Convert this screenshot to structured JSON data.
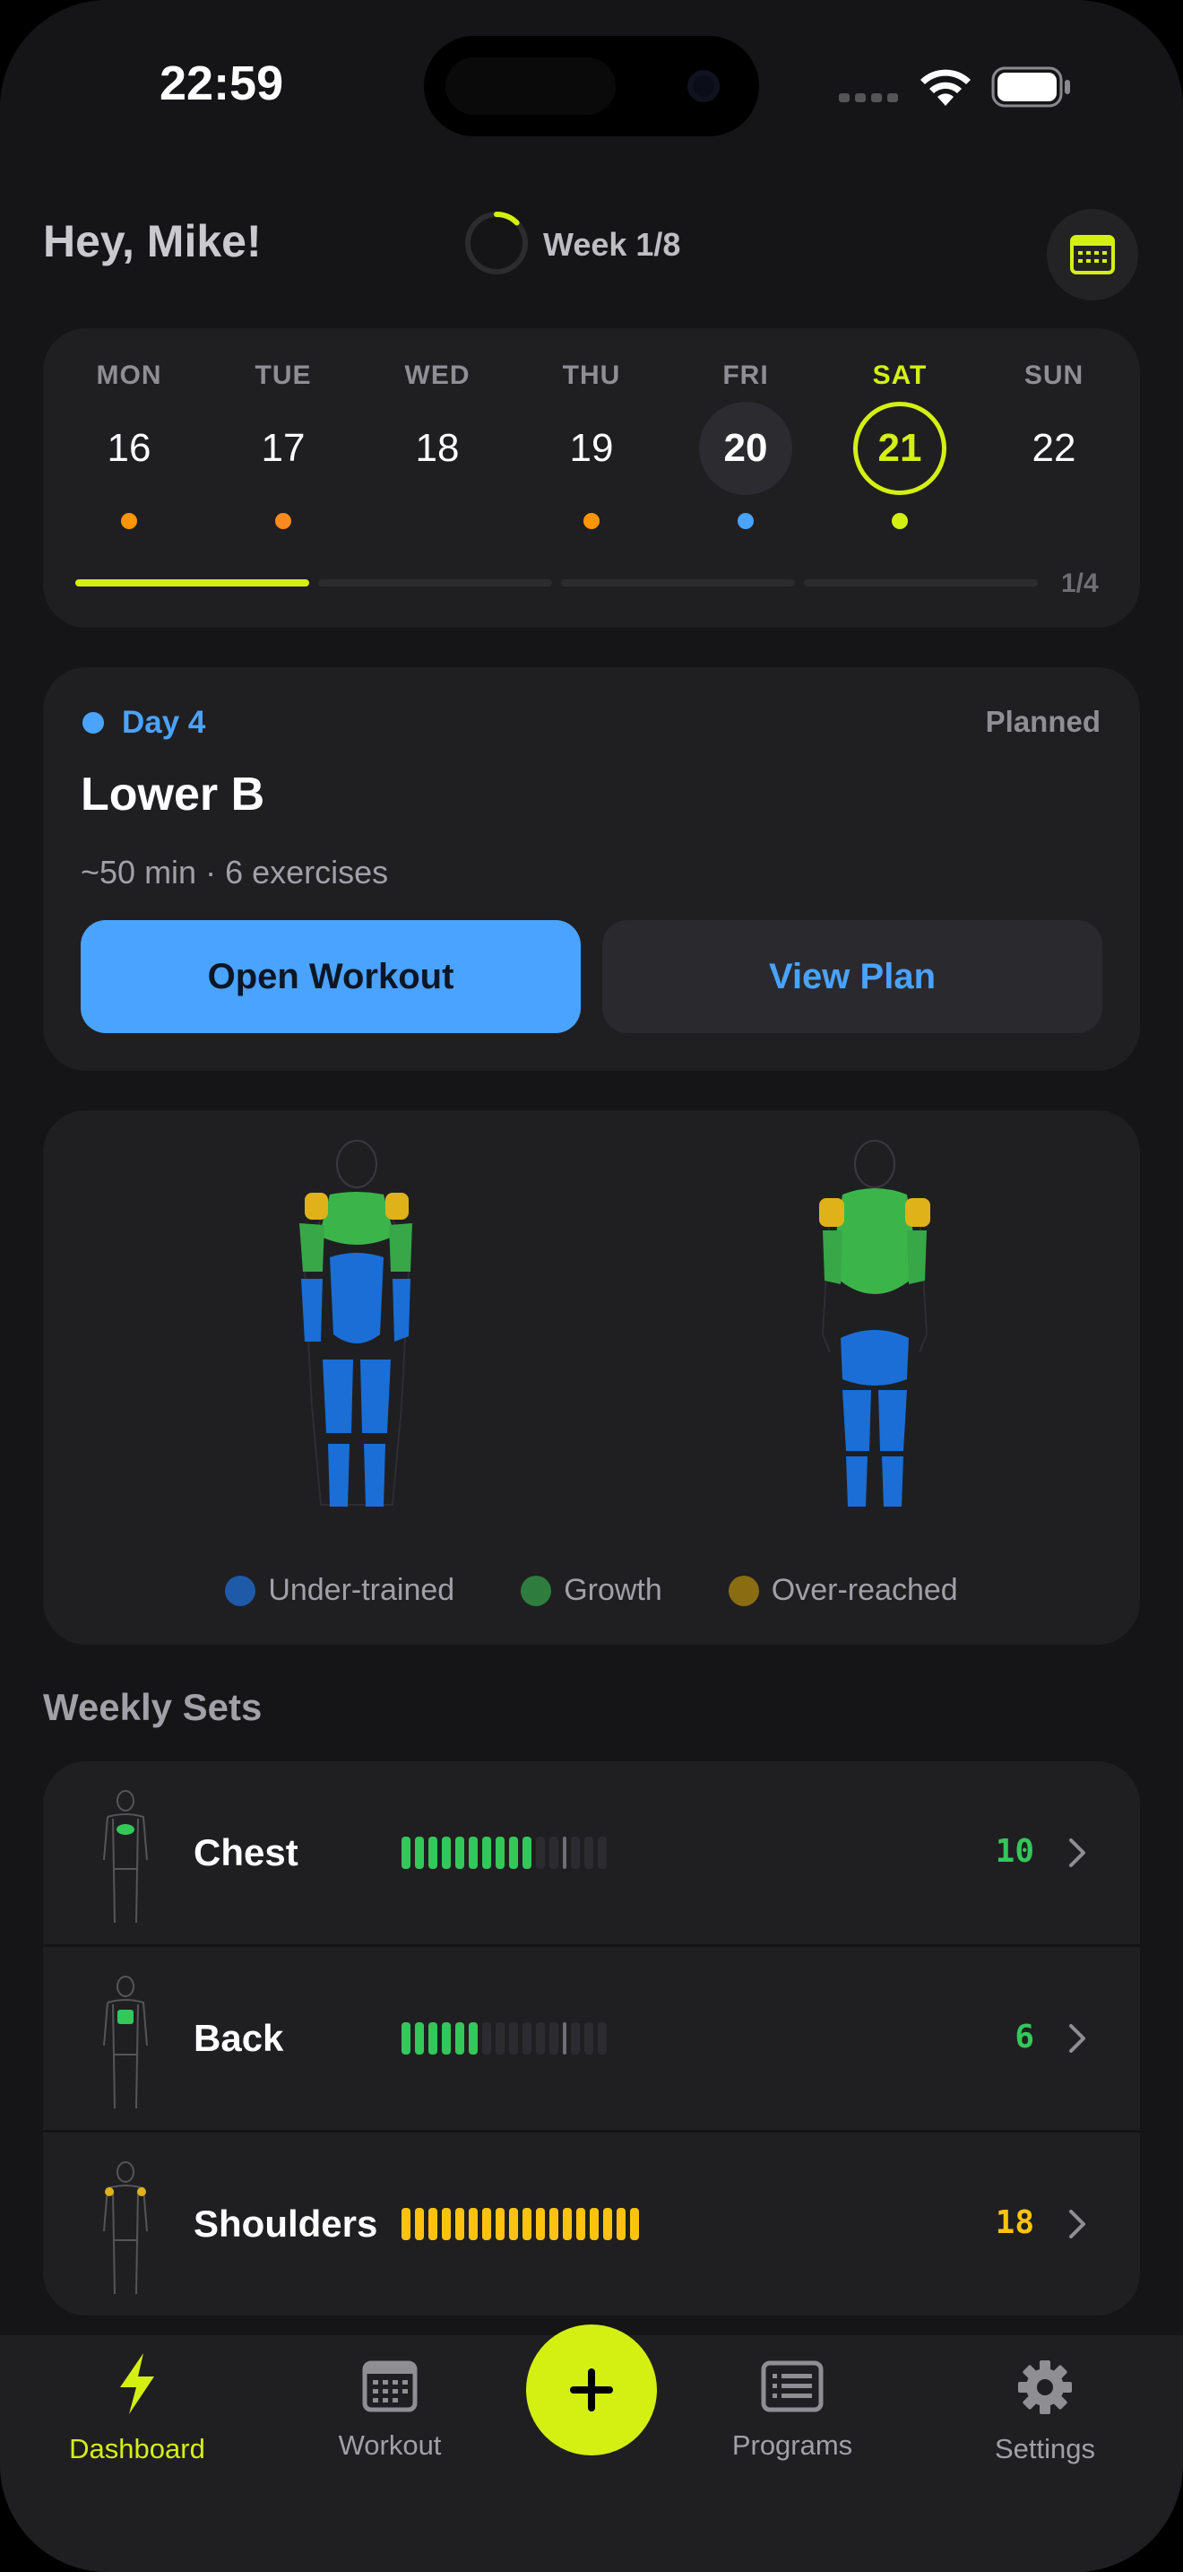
{
  "status_bar": {
    "time": "22:59"
  },
  "header": {
    "greeting": "Hey, Mike!",
    "week_label": "Week 1/8",
    "week_progress": 0.125
  },
  "calendar": {
    "days": [
      {
        "name": "MON",
        "num": "16",
        "dot_color": "#ff9500",
        "selected": false,
        "today": false
      },
      {
        "name": "TUE",
        "num": "17",
        "dot_color": "#ff8a1f",
        "selected": false,
        "today": false
      },
      {
        "name": "WED",
        "num": "18",
        "dot_color": "",
        "selected": false,
        "today": false
      },
      {
        "name": "THU",
        "num": "19",
        "dot_color": "#ff9500",
        "selected": false,
        "today": false
      },
      {
        "name": "FRI",
        "num": "20",
        "dot_color": "#4aa3ff",
        "selected": true,
        "today": false
      },
      {
        "name": "SAT",
        "num": "21",
        "dot_color": "#d4f012",
        "selected": false,
        "today": true
      },
      {
        "name": "SUN",
        "num": "22",
        "dot_color": "",
        "selected": false,
        "today": false
      }
    ],
    "page_label": "1/4",
    "progress_segments": 4,
    "progress_active": 1
  },
  "workout": {
    "day_label": "Day 4",
    "status": "Planned",
    "title": "Lower B",
    "meta": "~50 min · 6 exercises",
    "open_label": "Open Workout",
    "view_label": "View Plan"
  },
  "legend": [
    {
      "label": "Under-trained",
      "color": "#1f5aa8"
    },
    {
      "label": "Growth",
      "color": "#2e7d3e"
    },
    {
      "label": "Over-reached",
      "color": "#8a6d12"
    }
  ],
  "weekly_sets": {
    "title": "Weekly Sets",
    "rows": [
      {
        "label": "Chest",
        "count": "10",
        "filled": 10,
        "total": 16,
        "target": 12,
        "color": "#34c759"
      },
      {
        "label": "Back",
        "count": "6",
        "filled": 6,
        "total": 16,
        "target": 12,
        "color": "#34c759"
      },
      {
        "label": "Shoulders",
        "count": "18",
        "filled": 18,
        "total": 18,
        "target": 0,
        "color": "#ffc30f"
      }
    ]
  },
  "tabs": [
    {
      "label": "Dashboard",
      "icon": "bolt-icon",
      "active": true
    },
    {
      "label": "Workout",
      "icon": "calendar-icon",
      "active": false
    },
    {
      "label": "Programs",
      "icon": "list-icon",
      "active": false
    },
    {
      "label": "Settings",
      "icon": "gear-icon",
      "active": false
    }
  ],
  "colors": {
    "accent": "#d4f012",
    "blue": "#4aa3ff",
    "background": "#151517",
    "card": "#1f1f22"
  }
}
